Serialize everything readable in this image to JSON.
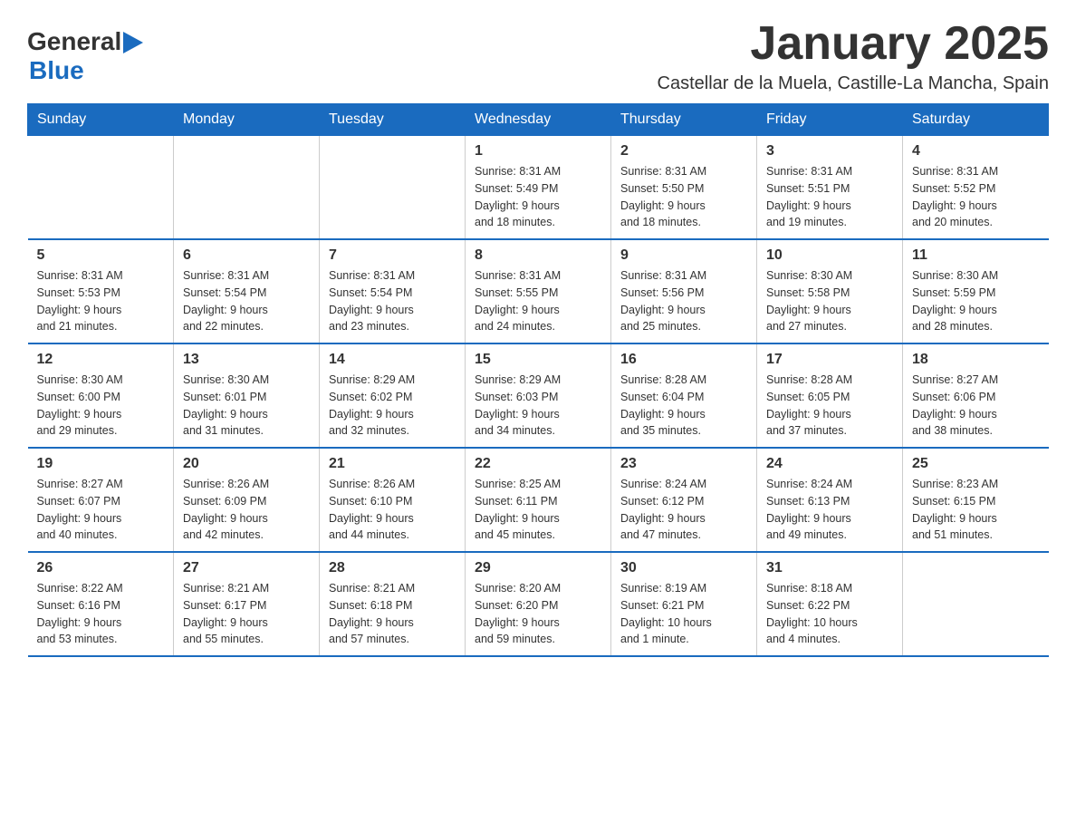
{
  "header": {
    "logo_general": "General",
    "logo_blue": "Blue",
    "main_title": "January 2025",
    "subtitle": "Castellar de la Muela, Castille-La Mancha, Spain"
  },
  "calendar": {
    "days_of_week": [
      "Sunday",
      "Monday",
      "Tuesday",
      "Wednesday",
      "Thursday",
      "Friday",
      "Saturday"
    ],
    "weeks": [
      [
        {
          "day": "",
          "info": ""
        },
        {
          "day": "",
          "info": ""
        },
        {
          "day": "",
          "info": ""
        },
        {
          "day": "1",
          "info": "Sunrise: 8:31 AM\nSunset: 5:49 PM\nDaylight: 9 hours\nand 18 minutes."
        },
        {
          "day": "2",
          "info": "Sunrise: 8:31 AM\nSunset: 5:50 PM\nDaylight: 9 hours\nand 18 minutes."
        },
        {
          "day": "3",
          "info": "Sunrise: 8:31 AM\nSunset: 5:51 PM\nDaylight: 9 hours\nand 19 minutes."
        },
        {
          "day": "4",
          "info": "Sunrise: 8:31 AM\nSunset: 5:52 PM\nDaylight: 9 hours\nand 20 minutes."
        }
      ],
      [
        {
          "day": "5",
          "info": "Sunrise: 8:31 AM\nSunset: 5:53 PM\nDaylight: 9 hours\nand 21 minutes."
        },
        {
          "day": "6",
          "info": "Sunrise: 8:31 AM\nSunset: 5:54 PM\nDaylight: 9 hours\nand 22 minutes."
        },
        {
          "day": "7",
          "info": "Sunrise: 8:31 AM\nSunset: 5:54 PM\nDaylight: 9 hours\nand 23 minutes."
        },
        {
          "day": "8",
          "info": "Sunrise: 8:31 AM\nSunset: 5:55 PM\nDaylight: 9 hours\nand 24 minutes."
        },
        {
          "day": "9",
          "info": "Sunrise: 8:31 AM\nSunset: 5:56 PM\nDaylight: 9 hours\nand 25 minutes."
        },
        {
          "day": "10",
          "info": "Sunrise: 8:30 AM\nSunset: 5:58 PM\nDaylight: 9 hours\nand 27 minutes."
        },
        {
          "day": "11",
          "info": "Sunrise: 8:30 AM\nSunset: 5:59 PM\nDaylight: 9 hours\nand 28 minutes."
        }
      ],
      [
        {
          "day": "12",
          "info": "Sunrise: 8:30 AM\nSunset: 6:00 PM\nDaylight: 9 hours\nand 29 minutes."
        },
        {
          "day": "13",
          "info": "Sunrise: 8:30 AM\nSunset: 6:01 PM\nDaylight: 9 hours\nand 31 minutes."
        },
        {
          "day": "14",
          "info": "Sunrise: 8:29 AM\nSunset: 6:02 PM\nDaylight: 9 hours\nand 32 minutes."
        },
        {
          "day": "15",
          "info": "Sunrise: 8:29 AM\nSunset: 6:03 PM\nDaylight: 9 hours\nand 34 minutes."
        },
        {
          "day": "16",
          "info": "Sunrise: 8:28 AM\nSunset: 6:04 PM\nDaylight: 9 hours\nand 35 minutes."
        },
        {
          "day": "17",
          "info": "Sunrise: 8:28 AM\nSunset: 6:05 PM\nDaylight: 9 hours\nand 37 minutes."
        },
        {
          "day": "18",
          "info": "Sunrise: 8:27 AM\nSunset: 6:06 PM\nDaylight: 9 hours\nand 38 minutes."
        }
      ],
      [
        {
          "day": "19",
          "info": "Sunrise: 8:27 AM\nSunset: 6:07 PM\nDaylight: 9 hours\nand 40 minutes."
        },
        {
          "day": "20",
          "info": "Sunrise: 8:26 AM\nSunset: 6:09 PM\nDaylight: 9 hours\nand 42 minutes."
        },
        {
          "day": "21",
          "info": "Sunrise: 8:26 AM\nSunset: 6:10 PM\nDaylight: 9 hours\nand 44 minutes."
        },
        {
          "day": "22",
          "info": "Sunrise: 8:25 AM\nSunset: 6:11 PM\nDaylight: 9 hours\nand 45 minutes."
        },
        {
          "day": "23",
          "info": "Sunrise: 8:24 AM\nSunset: 6:12 PM\nDaylight: 9 hours\nand 47 minutes."
        },
        {
          "day": "24",
          "info": "Sunrise: 8:24 AM\nSunset: 6:13 PM\nDaylight: 9 hours\nand 49 minutes."
        },
        {
          "day": "25",
          "info": "Sunrise: 8:23 AM\nSunset: 6:15 PM\nDaylight: 9 hours\nand 51 minutes."
        }
      ],
      [
        {
          "day": "26",
          "info": "Sunrise: 8:22 AM\nSunset: 6:16 PM\nDaylight: 9 hours\nand 53 minutes."
        },
        {
          "day": "27",
          "info": "Sunrise: 8:21 AM\nSunset: 6:17 PM\nDaylight: 9 hours\nand 55 minutes."
        },
        {
          "day": "28",
          "info": "Sunrise: 8:21 AM\nSunset: 6:18 PM\nDaylight: 9 hours\nand 57 minutes."
        },
        {
          "day": "29",
          "info": "Sunrise: 8:20 AM\nSunset: 6:20 PM\nDaylight: 9 hours\nand 59 minutes."
        },
        {
          "day": "30",
          "info": "Sunrise: 8:19 AM\nSunset: 6:21 PM\nDaylight: 10 hours\nand 1 minute."
        },
        {
          "day": "31",
          "info": "Sunrise: 8:18 AM\nSunset: 6:22 PM\nDaylight: 10 hours\nand 4 minutes."
        },
        {
          "day": "",
          "info": ""
        }
      ]
    ]
  }
}
